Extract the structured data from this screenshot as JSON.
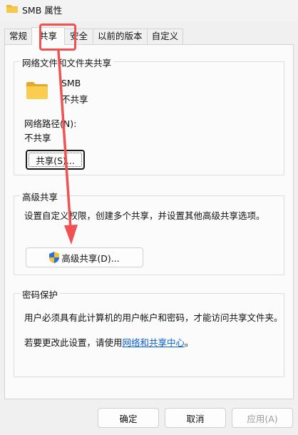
{
  "window": {
    "title": "SMB 属性",
    "icon": "folder-icon"
  },
  "tabs": [
    {
      "label": "常规",
      "active": false
    },
    {
      "label": "共享",
      "active": true
    },
    {
      "label": "安全",
      "active": false
    },
    {
      "label": "以前的版本",
      "active": false
    },
    {
      "label": "自定义",
      "active": false
    }
  ],
  "network_sharing": {
    "group_title": "网络文件和文件夹共享",
    "folder_name": "SMB",
    "folder_status": "不共享",
    "path_label": "网络路径(N):",
    "path_value": "不共享",
    "share_button": "共享(S)..."
  },
  "advanced_sharing": {
    "group_title": "高级共享",
    "description": "设置自定义权限，创建多个共享，并设置其他高级共享选项。",
    "button": "高级共享(D)..."
  },
  "password_protection": {
    "group_title": "密码保护",
    "description": "用户必须具有此计算机的用户帐户和密码，才能访问共享文件夹。",
    "change_prefix": "若要更改此设置，请使用",
    "link": "网络和共享中心",
    "change_suffix": "。"
  },
  "footer": {
    "ok": "确定",
    "cancel": "取消",
    "apply": "应用(A)"
  },
  "colors": {
    "annotation": "#ee5252",
    "link": "#0a5ed6",
    "folder": "#f7c948"
  }
}
